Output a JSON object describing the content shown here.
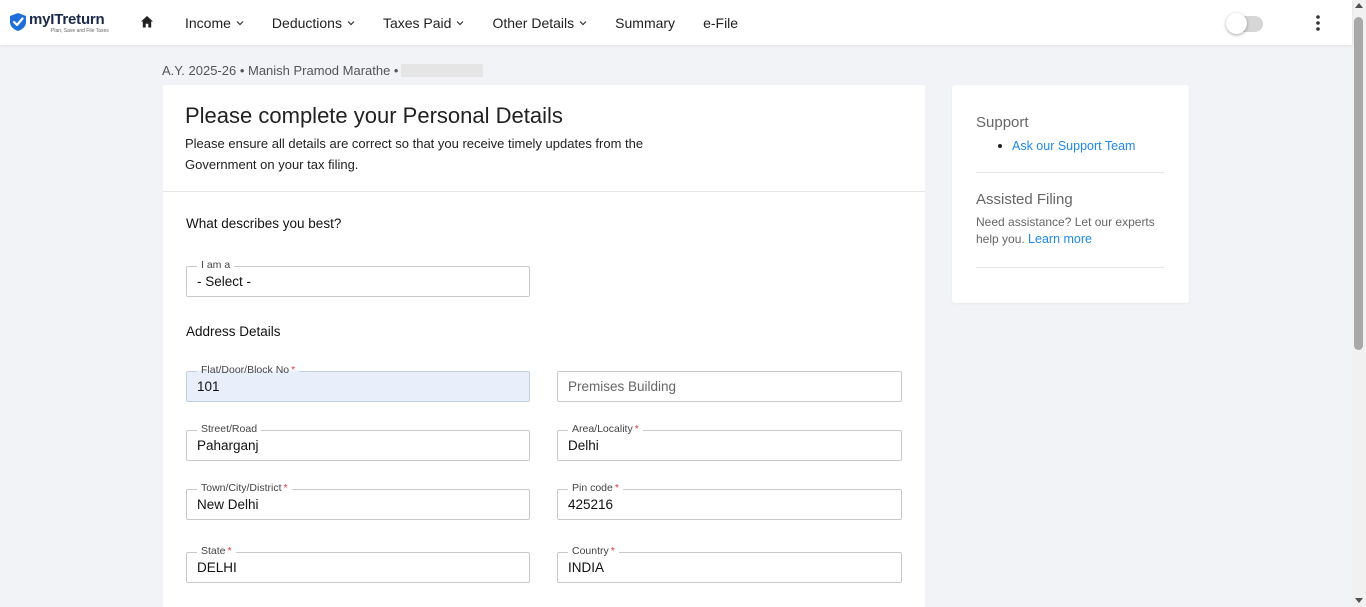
{
  "header": {
    "brand": "myITreturn",
    "tagline": "Plan, Save and File Taxes",
    "nav": [
      {
        "label": "Income",
        "has_dropdown": true
      },
      {
        "label": "Deductions",
        "has_dropdown": true
      },
      {
        "label": "Taxes Paid",
        "has_dropdown": true
      },
      {
        "label": "Other Details",
        "has_dropdown": true
      },
      {
        "label": "Summary",
        "has_dropdown": false
      },
      {
        "label": "e-File",
        "has_dropdown": false
      }
    ],
    "brand_color": "#1e6fd9"
  },
  "breadcrumb": {
    "text": "A.Y. 2025-26 • Manish Pramod Marathe •"
  },
  "main": {
    "title": "Please complete your Personal Details",
    "subtitle": "Please ensure all details are correct so that you receive timely updates from the Government on your tax filing.",
    "question": "What describes you best?",
    "iam": {
      "label": "I am a",
      "value": "- Select -"
    },
    "address_title": "Address Details",
    "fields": {
      "flat": {
        "label": "Flat/Door/Block No",
        "value": "101",
        "required": true
      },
      "premises": {
        "placeholder": "Premises Building"
      },
      "street": {
        "label": "Street/Road",
        "value": "Paharganj",
        "required": false
      },
      "area": {
        "label": "Area/Locality",
        "value": "Delhi",
        "required": true
      },
      "town": {
        "label": "Town/City/District",
        "value": "New Delhi",
        "required": true
      },
      "pincode": {
        "label": "Pin code",
        "value": "425216",
        "required": true
      },
      "state": {
        "label": "State",
        "value": "DELHI",
        "required": true
      },
      "country": {
        "label": "Country",
        "value": "INDIA",
        "required": true
      }
    },
    "required_mark": "*"
  },
  "sidebar": {
    "support_title": "Support",
    "support_link": "Ask our Support Team",
    "assisted_title": "Assisted Filing",
    "assisted_text": "Need assistance? Let our experts help you.",
    "learn_more": "Learn more",
    "link_color": "#1e88e5"
  },
  "icons": {
    "logo": "shield-check-icon",
    "home": "home-icon",
    "dropdown": "chevron-down-icon",
    "menu": "kebab-menu-icon"
  }
}
